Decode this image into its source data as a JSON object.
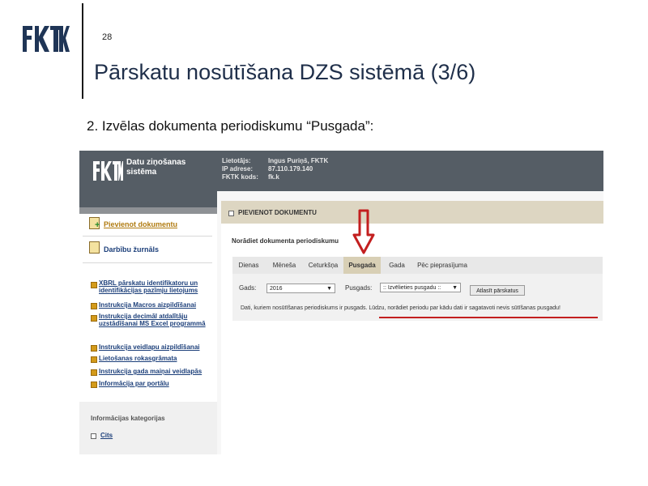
{
  "slide": {
    "page_number": "28",
    "title": "Pārskatu nosūtīšana DZS sistēmā (3/6)",
    "subtitle": "2. Izvēlas dokumenta periodiskumu “Pusgada”:",
    "logo": "fktk-logo"
  },
  "app": {
    "system_name_line1": "Datu ziņošanas",
    "system_name_line2": "sistēma",
    "user_info": {
      "labels": [
        "Lietotājs:",
        "IP adrese:",
        "FKTK kods:"
      ],
      "values": [
        "Ingus Puriņš, FKTK",
        "87.110.179.140",
        "fk.k"
      ]
    },
    "sidebar": {
      "main_items": [
        "Pievienot dokumentu",
        "Darbību žurnāls"
      ],
      "links": [
        "XBRL pārskatu identifikatoru un identifikācijas pazīmju lietojums",
        "Instrukcija Macros aizpildīšanai",
        "Instrukcija decimāl atdalītāju uzstādīšanai MS Excel programmā",
        "Instrukcija veidlapu aizpildīšanai",
        "Lietošanas rokasgrāmata",
        "Instrukcija gada maiņai veidlapās",
        "Informācija par portālu"
      ],
      "categories_title": "Informācijas kategorijas",
      "categories": [
        "Cits"
      ]
    },
    "panel": {
      "title": "PIEVIENOT DOKUMENTU",
      "prompt": "Norādiet dokumenta periodiskumu",
      "tabs": [
        "Dienas",
        "Mēneša",
        "Ceturkšņa",
        "Pusgada",
        "Gada",
        "Pēc pieprasījuma"
      ],
      "selected_tab": "Pusgada",
      "year_label": "Gads:",
      "year_value": "2016",
      "half_label": "Pusgads:",
      "half_value": ":: Izvēlieties pusgadu ::",
      "button_label": "Atlasīt pārskatus",
      "notice_part1": "Dati, kuriem nosūtīšanas periodiskums ir pusgads. ",
      "notice_part2": "Lūdzu, norādiet periodu par kādu dati ir sagatavoti nevis sūtīšanas pusgadu!"
    }
  },
  "colors": {
    "header_bar": "#555d65",
    "title_color": "#1f2f4a",
    "selected_tab": "#d8cfb5",
    "annotation_red": "#c31f1f"
  },
  "icons": [
    "fktk-logo",
    "add-document-icon",
    "journal-icon",
    "bullet-icon",
    "red-down-arrow-icon"
  ]
}
